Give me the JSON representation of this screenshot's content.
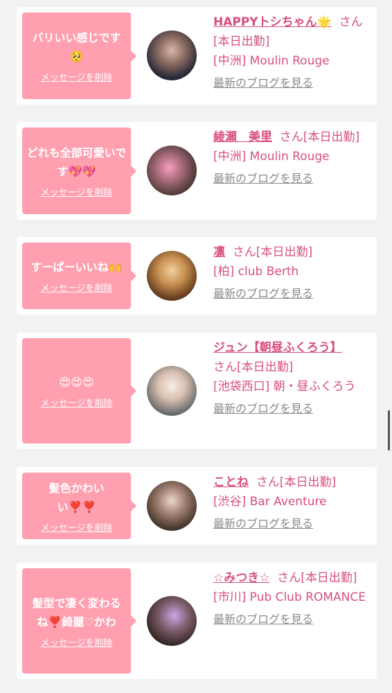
{
  "delete_label": "メッセージを削除",
  "blog_label": "最新のブログを見る",
  "entries": [
    {
      "message": "バリいい感じです🥺",
      "name": "HAPPYトシちゃん🌟",
      "suffix": "さん[本日出勤]",
      "shop": "[中洲] Moulin Rouge"
    },
    {
      "message": "どれも全部可愛いです💖💖",
      "name": "綾瀬　美里",
      "suffix": "さん[本日出勤]",
      "shop": "[中洲] Moulin Rouge"
    },
    {
      "message": "すーぱーいいね🙌",
      "name": "凛",
      "suffix": "さん[本日出勤]",
      "shop": "[柏] club Berth"
    },
    {
      "message": "😍😍😍",
      "name": "ジュン【朝昼ふくろう】",
      "suffix": "さん[本日出勤]",
      "shop": "[池袋西口] 朝・昼ふくろう"
    },
    {
      "message": "髪色かわいい❣️❣️",
      "name": "ことね",
      "suffix": "さん[本日出勤]",
      "shop": "[渋谷] Bar Aventure"
    },
    {
      "message": "髪型で凄く変わるね❣️綺麗♡かわ",
      "name": "☆みつき☆",
      "suffix": "さん[本日出勤]",
      "shop": "[市川] Pub Club ROMANCE"
    }
  ]
}
